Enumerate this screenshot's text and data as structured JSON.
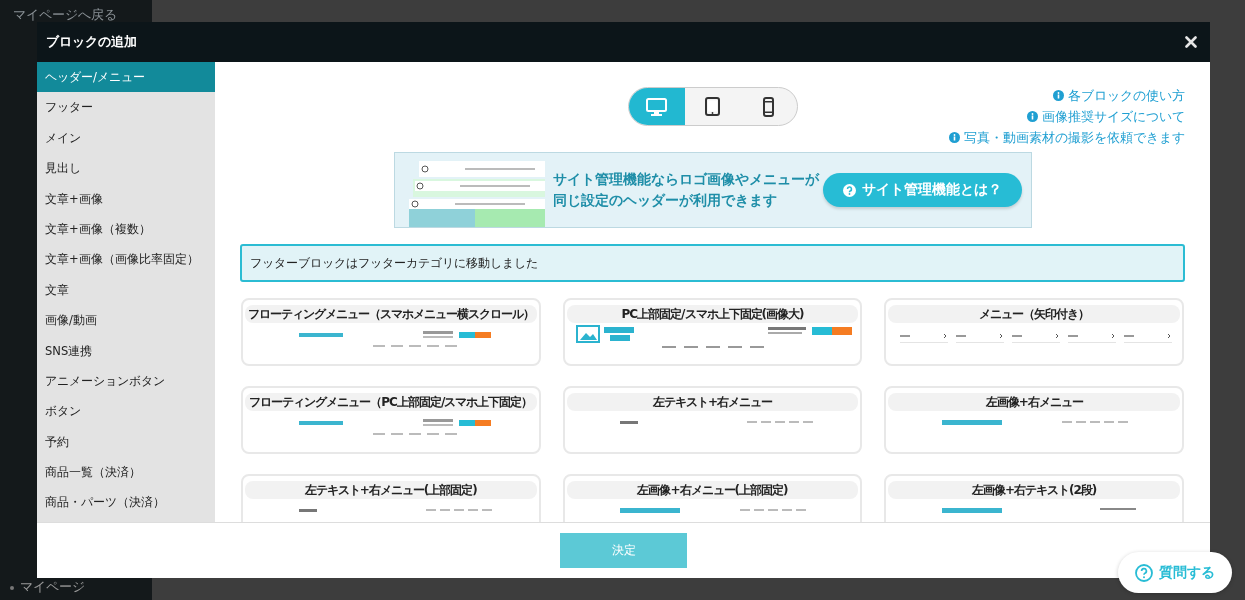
{
  "background": {
    "back_link": "マイページへ戻る",
    "footer_item": "マイページ"
  },
  "dialog": {
    "title": "ブロックの追加",
    "categories": [
      {
        "label": "ヘッダー/メニュー",
        "selected": true
      },
      {
        "label": "フッター",
        "selected": false
      },
      {
        "label": "メイン",
        "selected": false
      },
      {
        "label": "見出し",
        "selected": false
      },
      {
        "label": "文章+画像",
        "selected": false
      },
      {
        "label": "文章+画像（複数）",
        "selected": false
      },
      {
        "label": "文章+画像（画像比率固定）",
        "selected": false
      },
      {
        "label": "文章",
        "selected": false
      },
      {
        "label": "画像/動画",
        "selected": false
      },
      {
        "label": "SNS連携",
        "selected": false
      },
      {
        "label": "アニメーションボタン",
        "selected": false
      },
      {
        "label": "ボタン",
        "selected": false
      },
      {
        "label": "予約",
        "selected": false
      },
      {
        "label": "商品一覧（決済）",
        "selected": false
      },
      {
        "label": "商品・パーツ（決済）",
        "selected": false
      }
    ],
    "device_toggle": [
      {
        "kind": "desktop",
        "selected": true
      },
      {
        "kind": "tablet",
        "selected": false
      },
      {
        "kind": "phone",
        "selected": false
      }
    ],
    "help_links": [
      "各ブロックの使い方",
      "画像推奨サイズについて",
      "写真・動画素材の撮影を依頼できます"
    ],
    "banner": {
      "text_lines": [
        "サイト管理機能ならロゴ画像やメニューが",
        "同じ設定のヘッダーが利用できます"
      ],
      "button": "サイト管理機能とは？"
    },
    "notice": "フッターブロックはフッターカテゴリに移動しました",
    "blocks": [
      {
        "title": "フローティングメニュー（スマホメニュー横スクロール）",
        "kind": "logo-tel"
      },
      {
        "title": "PC上部固定/スマホ上下固定(画像大)",
        "kind": "big-logo"
      },
      {
        "title": "メニュー（矢印付き）",
        "kind": "arrows"
      },
      {
        "title": "フローティングメニュー（PC上部固定/スマホ上下固定）",
        "kind": "logo-tel"
      },
      {
        "title": "左テキスト+右メニュー",
        "kind": "text-menu"
      },
      {
        "title": "左画像+右メニュー",
        "kind": "logo-menu"
      },
      {
        "title": "左テキスト+右メニュー(上部固定)",
        "kind": "text-menu"
      },
      {
        "title": "左画像+右メニュー(上部固定)",
        "kind": "logo-menu"
      },
      {
        "title": "左画像+右テキスト(2段)",
        "kind": "logo-text"
      }
    ],
    "confirm_button": "決定"
  },
  "help_button": "質問する"
}
